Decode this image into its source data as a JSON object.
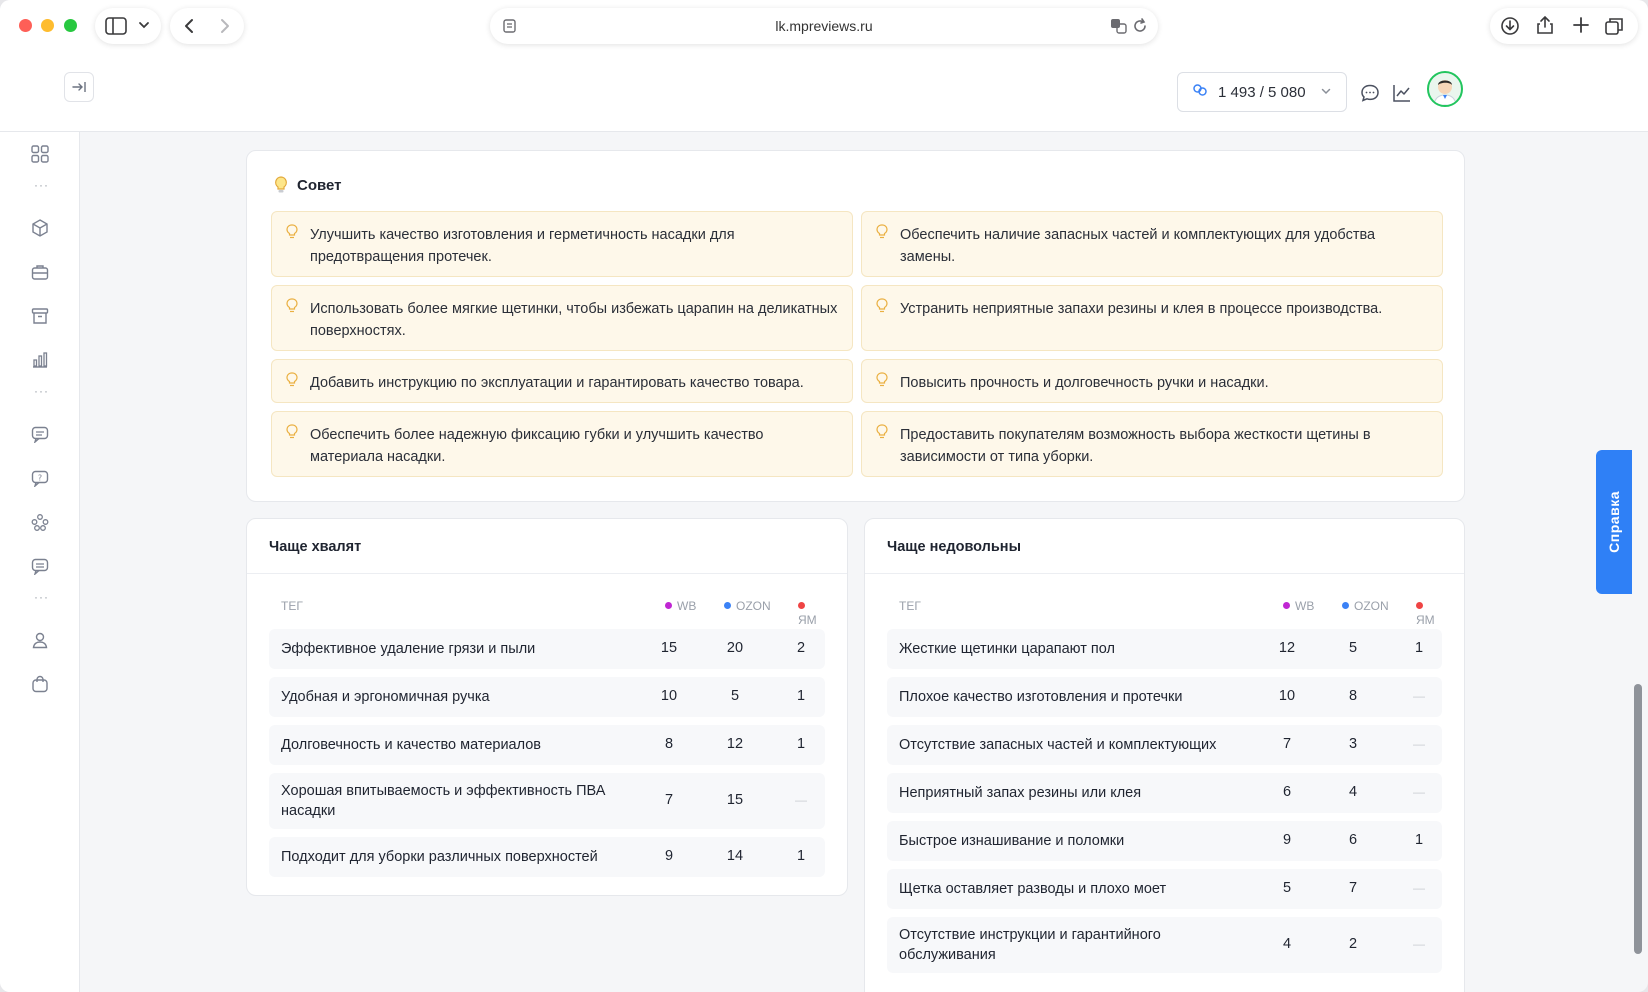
{
  "browser": {
    "url": "lk.mpreviews.ru"
  },
  "header": {
    "credits": "1 493 / 5 080"
  },
  "advice": {
    "title": "Совет",
    "tips": [
      "Улучшить качество изготовления и герметичность насадки для предотвращения протечек.",
      "Обеспечить наличие запасных частей и комплектующих для удобства замены.",
      "Использовать более мягкие щетинки, чтобы избежать царапин на деликатных поверхностях.",
      "Устранить неприятные запахи резины и клея в процессе производства.",
      "Добавить инструкцию по эксплуатации и гарантировать качество товара.",
      "Повысить прочность и долговечность ручки и насадки.",
      "Обеспечить более надежную фиксацию губки и улучшить качество материала насадки.",
      "Предоставить покупателям возможность выбора жесткости щетины в зависимости от типа уборки."
    ]
  },
  "columns": {
    "tag": "ТЕГ",
    "wb": "WB",
    "ozon": "OZON",
    "ym": "ЯМ"
  },
  "marketplace_colors": {
    "wb": "#c026d3",
    "ozon": "#3b82f6",
    "ym": "#ef4444"
  },
  "praise": {
    "title": "Чаще хвалят",
    "rows": [
      {
        "tag": "Эффективное удаление грязи и пыли",
        "wb": "15",
        "ozon": "20",
        "ym": "2"
      },
      {
        "tag": "Удобная и эргономичная ручка",
        "wb": "10",
        "ozon": "5",
        "ym": "1"
      },
      {
        "tag": "Долговечность и качество материалов",
        "wb": "8",
        "ozon": "12",
        "ym": "1"
      },
      {
        "tag": "Хорошая впитываемость и эффективность ПВА насадки",
        "wb": "7",
        "ozon": "15",
        "ym": "—"
      },
      {
        "tag": "Подходит для уборки различных поверхностей",
        "wb": "9",
        "ozon": "14",
        "ym": "1"
      }
    ]
  },
  "complaints": {
    "title": "Чаще недовольны",
    "rows": [
      {
        "tag": "Жесткие щетинки царапают пол",
        "wb": "12",
        "ozon": "5",
        "ym": "1"
      },
      {
        "tag": "Плохое качество изготовления и протечки",
        "wb": "10",
        "ozon": "8",
        "ym": "—"
      },
      {
        "tag": "Отсутствие запасных частей и комплектующих",
        "wb": "7",
        "ozon": "3",
        "ym": "—"
      },
      {
        "tag": "Неприятный запах резины или клея",
        "wb": "6",
        "ozon": "4",
        "ym": "—"
      },
      {
        "tag": "Быстрое изнашивание и поломки",
        "wb": "9",
        "ozon": "6",
        "ym": "1"
      },
      {
        "tag": "Щетка оставляет разводы и плохо моет",
        "wb": "5",
        "ozon": "7",
        "ym": "—"
      },
      {
        "tag": "Отсутствие инструкции и гарантийного обслуживания",
        "wb": "4",
        "ozon": "2",
        "ym": "—"
      }
    ]
  },
  "help_tab": "Справка"
}
